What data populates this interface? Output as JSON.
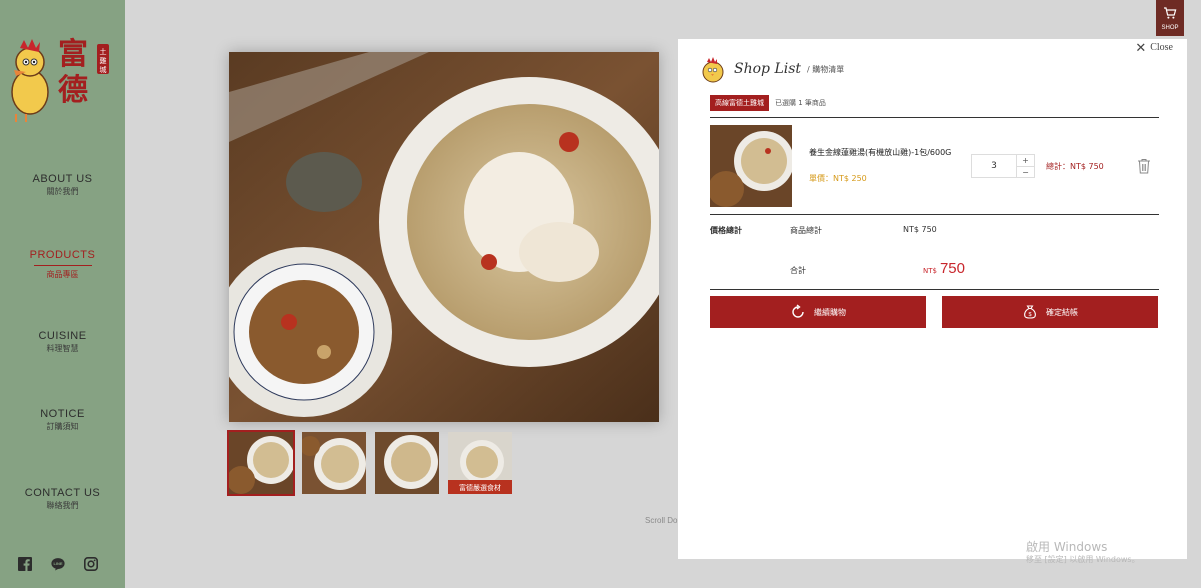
{
  "sidebar": {
    "brand": "富德",
    "brand_tag": "土雞城",
    "nav": [
      {
        "en": "ABOUT US",
        "zh": "關於我們"
      },
      {
        "en": "PRODUCTS",
        "zh": "商品專區"
      },
      {
        "en": "CUISINE",
        "zh": "料理智慧"
      },
      {
        "en": "NOTICE",
        "zh": "訂購須知"
      },
      {
        "en": "CONTACT US",
        "zh": "聯絡我們"
      }
    ],
    "social": [
      "facebook-icon",
      "line-icon",
      "instagram-icon"
    ]
  },
  "shop_button": {
    "label": "SHOP",
    "icon": "cart-icon"
  },
  "gallery": {
    "scroll_hint": "Scroll Do",
    "thumb_banner_text": "富德嚴選食材"
  },
  "cart": {
    "close_label": "Close",
    "title": "Shop List",
    "subtitle": "購物清單",
    "store_name": "高線富德土雞城",
    "store_count": "已選購 1 筆商品",
    "item": {
      "name": "養生金線蓮雞湯(有機放山雞)-1包/600G",
      "price_label": "單價：NT$ 250",
      "quantity": "3",
      "qty_up": "+",
      "qty_down": "−",
      "total_label": "總計：NT$ 750"
    },
    "summary": {
      "section_label": "價格總計",
      "subtotal_label": "商品總計",
      "subtotal_value": "NT$ 750",
      "total_label": "合計",
      "total_currency": "NT$",
      "total_value": "750"
    },
    "buttons": {
      "continue": "繼續購物",
      "checkout": "確定結帳"
    }
  },
  "watermark": {
    "line1": "啟用 Windows",
    "line2": "移至 [設定] 以啟用 Windows。"
  },
  "colors": {
    "accent": "#a31f1f",
    "sidebar": "#86a283",
    "price_gold": "#d69a1a"
  }
}
